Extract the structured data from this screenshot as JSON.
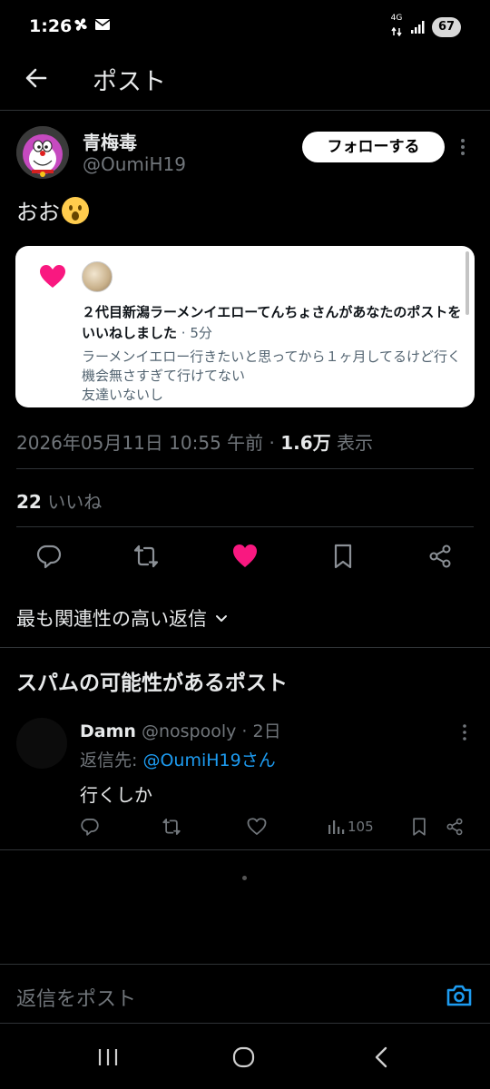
{
  "status_bar": {
    "time": "1:26",
    "network": "4G",
    "battery": "67"
  },
  "header": {
    "title": "ポスト"
  },
  "post": {
    "author_name": "青梅毒",
    "author_handle": "@OumiH19",
    "follow_label": "フォローする",
    "text": "おお",
    "emoji": "hushed-face-emoji",
    "screenshot": {
      "notification_title": "２代目新潟ラーメンイエローてんちょさんがあなたのポストをいいねしました",
      "notification_time": " · 5分",
      "quote_lines": [
        "ラーメンイエロー行きたいと思ってから１ヶ月してるけど行く機会無さすぎて行けてない",
        "友達いないし"
      ]
    },
    "timestamp": "2026年05月11日 10:55 午前 · ",
    "views_count": "1.6万",
    "views_label": " 表示",
    "likes_count": "22",
    "likes_label": " いいね"
  },
  "sort": {
    "label": "最も関連性の高い返信"
  },
  "spam_section": {
    "heading": "スパムの可能性があるポスト"
  },
  "reply": {
    "name": "Damn",
    "handle": " @nospooly · 2日",
    "reply_to_prefix": "返信先: ",
    "reply_to_mention": "@OumiH19さん",
    "text": "行くしか",
    "views": "105"
  },
  "reply_bar": {
    "placeholder": "返信をポスト"
  },
  "colors": {
    "like_pink": "#f91880",
    "link_blue": "#1d9bf0",
    "muted": "#71767b"
  }
}
